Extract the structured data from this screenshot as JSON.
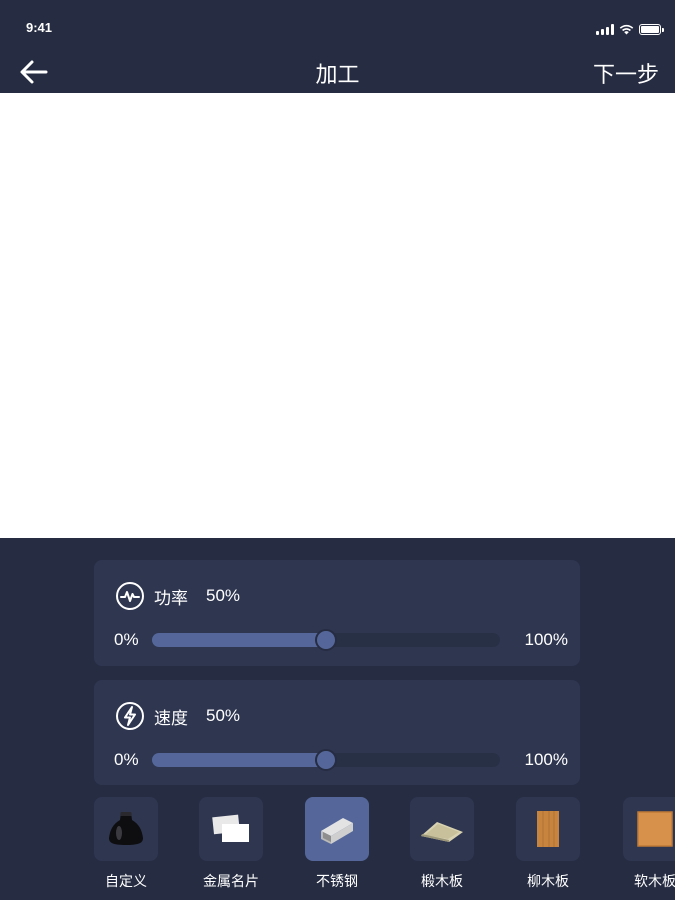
{
  "status_bar": {
    "time": "9:41"
  },
  "nav": {
    "title": "加工",
    "next_label": "下一步"
  },
  "power": {
    "label": "功率",
    "value_text": "50%",
    "min_label": "0%",
    "max_label": "100%",
    "value": 0.5
  },
  "speed": {
    "label": "速度",
    "value_text": "50%",
    "min_label": "0%",
    "max_label": "100%",
    "value": 0.5
  },
  "materials": {
    "selected_index": 2,
    "items": [
      {
        "label": "自定义",
        "icon": "custom-material-icon"
      },
      {
        "label": "金属名片",
        "icon": "metal-card-icon"
      },
      {
        "label": "不锈钢",
        "icon": "stainless-steel-icon"
      },
      {
        "label": "椴木板",
        "icon": "basswood-board-icon"
      },
      {
        "label": "柳木板",
        "icon": "willow-board-icon"
      },
      {
        "label": "软木板",
        "icon": "cork-board-icon"
      }
    ]
  },
  "colors": {
    "header_bg": "#262c42",
    "card_bg": "#2f3650",
    "accent": "#55679a",
    "track_bg": "#283046"
  }
}
